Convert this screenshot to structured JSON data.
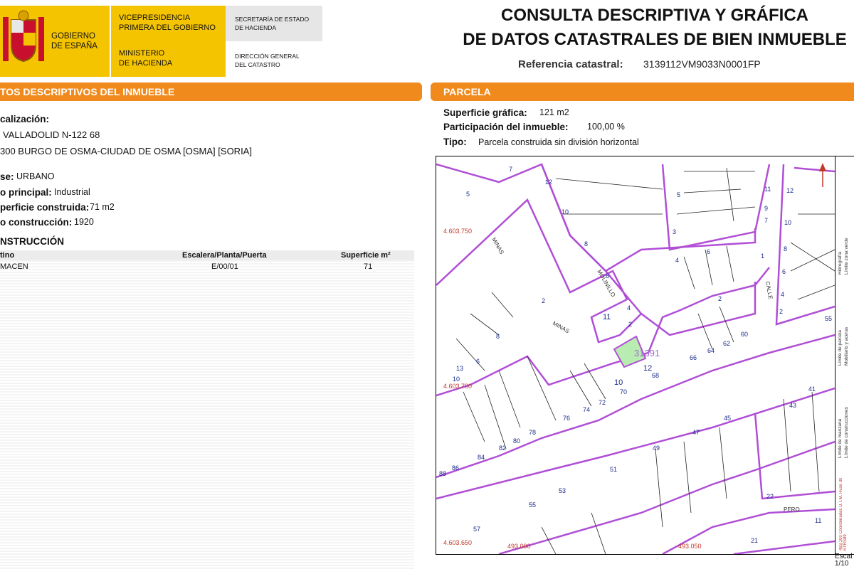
{
  "header": {
    "gobierno": [
      "GOBIERNO",
      "DE ESPAÑA"
    ],
    "vicepresidencia": [
      "VICEPRESIDENCIA",
      "PRIMERA DEL GOBIERNO"
    ],
    "ministerio": [
      "MINISTERIO",
      "DE HACIENDA"
    ],
    "secretaria": [
      "SECRETARÍA DE ESTADO",
      "DE HACIENDA"
    ],
    "direccion": [
      "DIRECCIÓN GENERAL",
      "DEL CATASTRO"
    ],
    "title_line1": "CONSULTA DESCRIPTIVA Y GRÁFICA",
    "title_line2": "DE DATOS CATASTRALES DE BIEN INMUEBLE",
    "ref_label": "Referencia catastral:",
    "ref_value": "3139112VM9033N0001FP"
  },
  "colors": {
    "brand_yellow": "#f5c400",
    "section_orange": "#f08a1d",
    "parcel_purple": "#b04fd6",
    "highlight_green": "#b8ecb0"
  },
  "left": {
    "section_title": "TOS DESCRIPTIVOS DEL INMUEBLE",
    "localizacion_label": "calización:",
    "address1": "VALLADOLID N-122 68",
    "address2": "300 BURGO DE OSMA-CIUDAD DE OSMA [OSMA] [SORIA]",
    "clase_label": "se:",
    "clase_value": "URBANO",
    "uso_label": "o principal:",
    "uso_value": "Industrial",
    "superficie_label": "perficie construida:",
    "superficie_value": "71 m2",
    "anio_label": "o construcción:",
    "anio_value": "1920",
    "construccion_title": "NSTRUCCIÓN",
    "table": {
      "headers": [
        "tino",
        "Escalera/Planta/Puerta",
        "Superficie m²"
      ],
      "rows": [
        [
          "MACEN",
          "E/00/01",
          "71"
        ]
      ]
    }
  },
  "right": {
    "section_title": "PARCELA",
    "sup_grafica_label": "Superficie gráfica:",
    "sup_grafica_value": "121 m2",
    "participacion_label": "Participación del inmueble:",
    "participacion_value": "100,00 %",
    "tipo_label": "Tipo:",
    "tipo_value": "Parcela construida sin división horizontal"
  },
  "map": {
    "coords": {
      "y_top": "4.603.750",
      "y_mid": "4.603.700",
      "y_bot": "4.603.650",
      "x1": "493.000",
      "x2": "493.050"
    },
    "parcel_ref": "31391",
    "street_labels": [
      "MINAS",
      "MINAS",
      "MOLINILLO",
      "CALLE",
      "PERO"
    ],
    "numbers": [
      "7",
      "5",
      "12",
      "10",
      "8",
      "6",
      "4",
      "2",
      "8",
      "6",
      "10",
      "13",
      "11",
      "12",
      "10",
      "70",
      "68",
      "72",
      "74",
      "76",
      "78",
      "80",
      "82",
      "84",
      "86",
      "88",
      "66",
      "64",
      "62",
      "60",
      "4",
      "6",
      "2",
      "1",
      "2",
      "3",
      "5",
      "11",
      "9",
      "7",
      "12",
      "10",
      "8",
      "6",
      "4",
      "2",
      "55",
      "43",
      "41",
      "45",
      "47",
      "49",
      "51",
      "53",
      "55",
      "57",
      "22",
      "21",
      "11"
    ],
    "legend": [
      "Hidrografía",
      "Límite zona verde",
      "Límite de parcela",
      "Mobiliario y aceras",
      "Límite de manzana",
      "Límite de construcciones"
    ],
    "coord_note": "493,100 Coordenadas U.T.M. Huso 30 ETRS89",
    "scale_label": "Escal",
    "scale_value": "1/10"
  }
}
